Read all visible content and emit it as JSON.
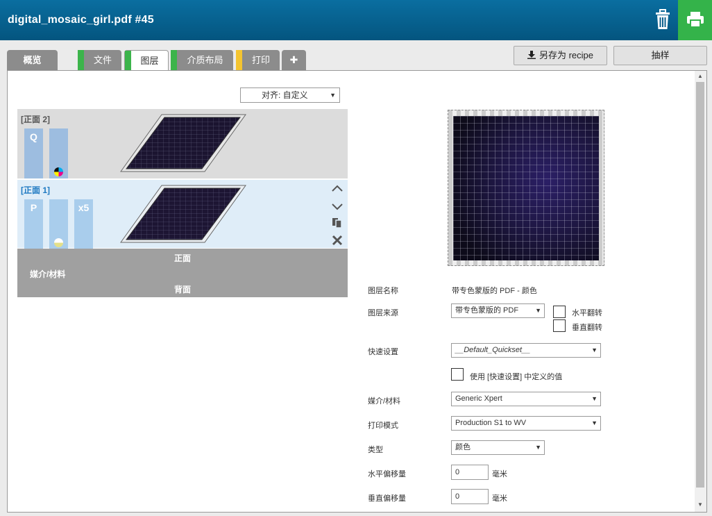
{
  "header": {
    "title": "digital_mosaic_girl.pdf #45"
  },
  "tabs": [
    {
      "label": "概览",
      "stripe": ""
    },
    {
      "label": "文件",
      "stripe": "#3cb44b"
    },
    {
      "label": "图层",
      "stripe": "#3cb44b"
    },
    {
      "label": "介质布局",
      "stripe": "#3cb44b"
    },
    {
      "label": "打印",
      "stripe": "#f4c430"
    },
    {
      "label": "✚",
      "stripe": ""
    }
  ],
  "actions": {
    "save_recipe": "另存为 recipe",
    "sample": "抽样"
  },
  "align": {
    "value": "对齐: 自定义"
  },
  "sides": {
    "back": {
      "label": "[正面 2]",
      "chips": [
        "Q",
        ""
      ]
    },
    "front": {
      "label": "[正面 1]",
      "chips": [
        "P",
        "",
        "x5"
      ]
    }
  },
  "media_bar": {
    "front": "正面",
    "media": "媒介/材料",
    "back": "背面"
  },
  "form": {
    "layer_name_label": "图层名称",
    "layer_name_value": "带专色蒙版的 PDF - 颜色",
    "layer_source_label": "图层来源",
    "layer_source_value": "带专色蒙版的 PDF",
    "flip_h": "水平翻转",
    "flip_v": "垂直翻转",
    "quickset_label": "快速设置",
    "quickset_value": "__Default_Quickset__",
    "use_quickset": "使用 [快速设置] 中定义的值",
    "media_label": "媒介/材料",
    "media_value": "Generic Xpert",
    "print_mode_label": "打印模式",
    "print_mode_value": "Production S1 to WV",
    "type_label": "类型",
    "type_value": "颜色",
    "h_offset_label": "水平偏移量",
    "h_offset_value": "0",
    "v_offset_label": "垂直偏移量",
    "v_offset_value": "0",
    "unit": "毫米"
  }
}
